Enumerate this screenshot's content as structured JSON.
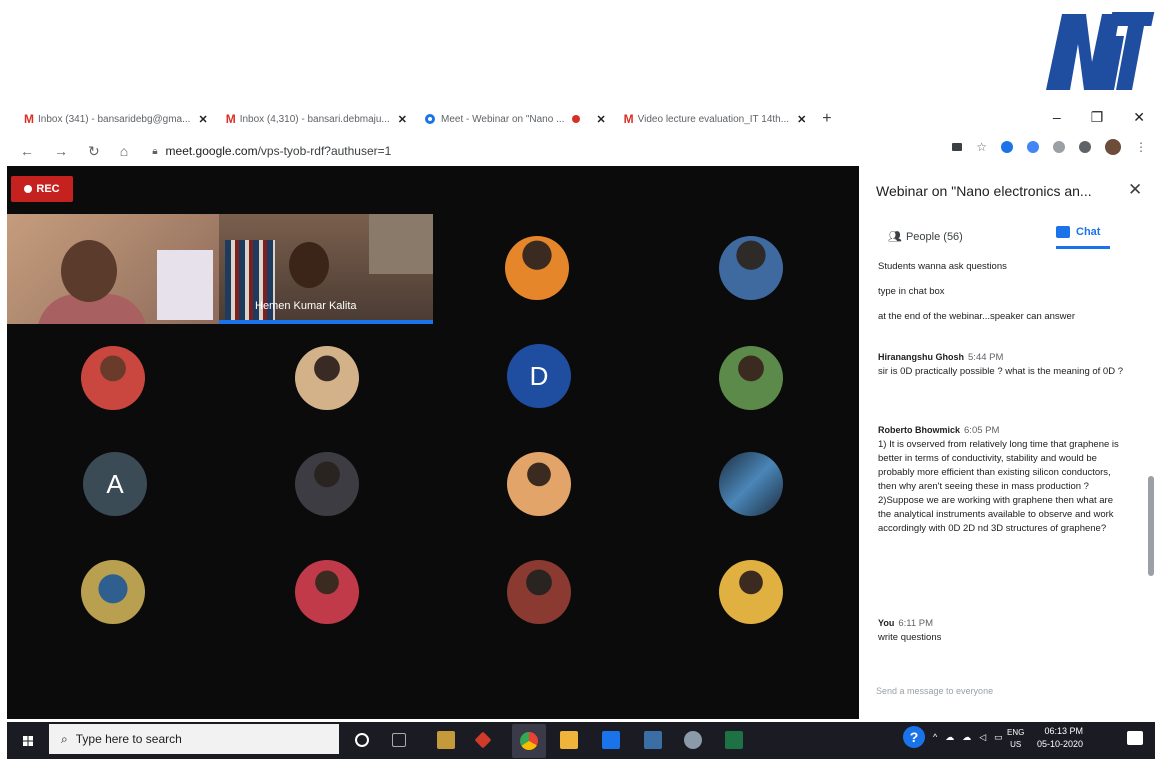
{
  "logo": {
    "text": "NiT"
  },
  "tabs": [
    {
      "label": "Inbox (341) - bansaridebg@gma...",
      "icon": "gmail-icon"
    },
    {
      "label": "Inbox (4,310) - bansari.debmaju...",
      "icon": "gmail-icon"
    },
    {
      "label": "Meet - Webinar on \"Nano ...",
      "icon": "meet-icon"
    },
    {
      "label": "Video lecture evaluation_IT 14th...",
      "icon": "gmail-icon"
    }
  ],
  "address": {
    "host": "meet.google.com",
    "path": "/vps-tyob-rdf?authuser=1"
  },
  "rec_label": "REC",
  "participant_name": "Hemen Kumar Kalita",
  "avatars": [
    "D",
    "A"
  ],
  "panel": {
    "title": "Webinar on \"Nano electronics an...",
    "people_tab": "People (56)",
    "chat_tab": "Chat",
    "lines": [
      "Students wanna ask questions",
      "type in chat box",
      "at the end of the webinar...speaker can answer"
    ],
    "messages": [
      {
        "sender": "Hiranangshu Ghosh",
        "time": "5:44 PM",
        "text": "sir is 0D practically possible ? what is the meaning of 0D ?"
      },
      {
        "sender": "Roberto Bhowmick",
        "time": "6:05 PM",
        "text1": "1) It is ovserved from relatively long time that graphene is better in terms of conductivity, stability and would be probably more efficient than existing silicon conductors, then why aren't seeing these in mass production ?",
        "text2": "2)Suppose we are working with graphene then what are the analytical instruments available to observe and work accordingly with 0D 2D nd 3D structures of graphene?"
      },
      {
        "sender": "You",
        "time": "6:11 PM",
        "text": "write questions"
      }
    ],
    "send_placeholder": "Send a message to everyone"
  },
  "taskbar": {
    "search_placeholder": "Type here to search",
    "lang": "ENG",
    "region": "US",
    "time": "06:13 PM",
    "date": "05-10-2020"
  }
}
